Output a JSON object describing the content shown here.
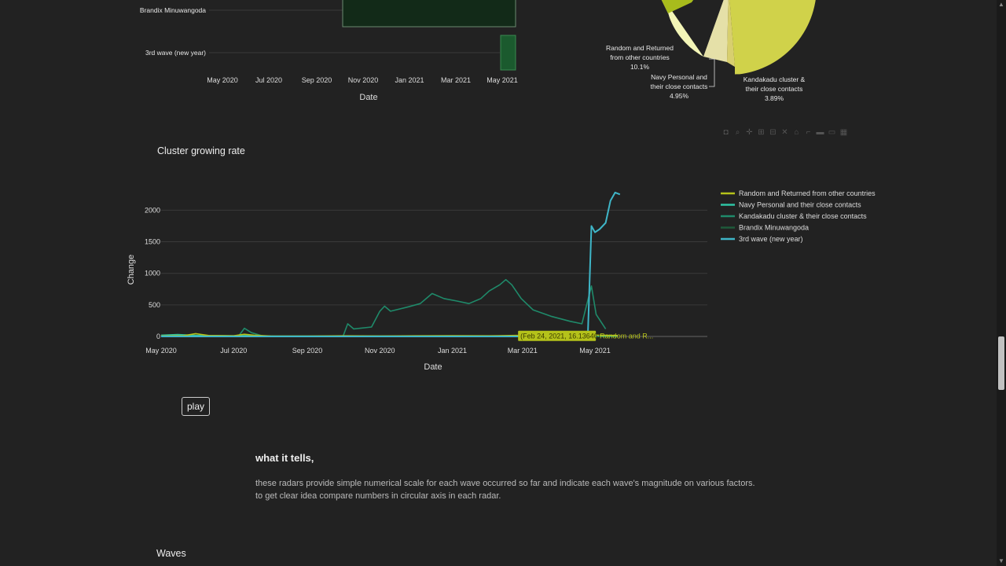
{
  "colors": {
    "background": "#222222",
    "random": "#b5c21a",
    "navy": "#2ec4a4",
    "kandakadu": "#1f8a6a",
    "brandix": "#1e5b3b",
    "third_wave": "#3fb6c8",
    "pie_random": "#f3f5b7",
    "pie_navy": "#e5e0a8",
    "pie_kandakadu": "#d8cf6e",
    "pie_main": "#d0d24a",
    "pie_green": "#a8bc1c"
  },
  "top_chart": {
    "categories": [
      "Brandix Minuwangoda",
      "3rd wave (new year)"
    ],
    "x_ticks": [
      "May 2020",
      "Jul 2020",
      "Sep 2020",
      "Nov 2020",
      "Jan 2021",
      "Mar 2021",
      "May 2021"
    ],
    "x_title": "Date"
  },
  "pie": {
    "labels": [
      {
        "lines": [
          "Random and Returned",
          "from other countries"
        ],
        "pct": "10.1%"
      },
      {
        "lines": [
          "Navy Personal and",
          "their close contacts"
        ],
        "pct": "4.95%"
      },
      {
        "lines": [
          "Kandakadu cluster &",
          "their close contacts"
        ],
        "pct": "3.89%"
      }
    ]
  },
  "modebar": {
    "icons": [
      "camera-icon",
      "zoom-icon",
      "pan-icon",
      "zoom-in-icon",
      "zoom-out-icon",
      "autoscale-icon",
      "reset-icon",
      "spike-icon",
      "compare-icon",
      "plotly-logo-icon"
    ]
  },
  "chart_title": "Cluster growing rate",
  "chart_data": {
    "type": "line",
    "title": "Cluster growing rate",
    "xlabel": "Date",
    "ylabel": "Change",
    "x_ticks": [
      "May 2020",
      "Jul 2020",
      "Sep 2020",
      "Nov 2020",
      "Jan 2021",
      "Mar 2021",
      "May 2021"
    ],
    "x_range": [
      "2020-05-01",
      "2021-05-31"
    ],
    "y_ticks": [
      0,
      500,
      1000,
      1500,
      2000
    ],
    "ylim": [
      -20,
      2300
    ],
    "legend_position": "top-right",
    "series": [
      {
        "name": "Random and Returned from other countries",
        "points": [
          [
            "2020-05-01",
            8
          ],
          [
            "2020-05-20",
            12
          ],
          [
            "2020-05-30",
            45
          ],
          [
            "2020-06-10",
            15
          ],
          [
            "2020-07-01",
            10
          ],
          [
            "2020-07-10",
            35
          ],
          [
            "2020-07-18",
            20
          ],
          [
            "2020-08-01",
            8
          ],
          [
            "2020-09-01",
            5
          ],
          [
            "2020-10-01",
            10
          ],
          [
            "2020-11-01",
            8
          ],
          [
            "2020-12-01",
            10
          ],
          [
            "2021-01-01",
            12
          ],
          [
            "2021-02-01",
            10
          ],
          [
            "2021-02-24",
            16
          ],
          [
            "2021-03-10",
            10
          ],
          [
            "2021-04-01",
            12
          ],
          [
            "2021-05-01",
            20
          ],
          [
            "2021-05-20",
            15
          ]
        ]
      },
      {
        "name": "Navy Personal and their close contacts",
        "points": [
          [
            "2020-05-01",
            20
          ],
          [
            "2020-05-15",
            30
          ],
          [
            "2020-06-01",
            15
          ],
          [
            "2020-07-01",
            10
          ],
          [
            "2020-07-12",
            15
          ],
          [
            "2020-08-01",
            5
          ],
          [
            "2021-05-20",
            5
          ]
        ]
      },
      {
        "name": "Kandakadu cluster & their close contacts",
        "points": [
          [
            "2020-05-01",
            0
          ],
          [
            "2020-07-05",
            0
          ],
          [
            "2020-07-10",
            130
          ],
          [
            "2020-07-16",
            60
          ],
          [
            "2020-07-25",
            10
          ],
          [
            "2020-08-10",
            0
          ],
          [
            "2020-10-01",
            0
          ],
          [
            "2020-10-05",
            200
          ],
          [
            "2020-10-10",
            120
          ],
          [
            "2020-10-25",
            150
          ],
          [
            "2020-11-01",
            400
          ],
          [
            "2020-11-05",
            480
          ],
          [
            "2020-11-10",
            400
          ],
          [
            "2020-11-25",
            470
          ],
          [
            "2020-12-05",
            520
          ],
          [
            "2020-12-15",
            680
          ],
          [
            "2020-12-25",
            600
          ],
          [
            "2021-01-05",
            560
          ],
          [
            "2021-01-15",
            520
          ],
          [
            "2021-01-25",
            600
          ],
          [
            "2021-02-01",
            720
          ],
          [
            "2021-02-10",
            820
          ],
          [
            "2021-02-15",
            900
          ],
          [
            "2021-02-20",
            820
          ],
          [
            "2021-02-28",
            600
          ],
          [
            "2021-03-10",
            420
          ],
          [
            "2021-03-25",
            320
          ],
          [
            "2021-04-10",
            240
          ],
          [
            "2021-04-20",
            200
          ],
          [
            "2021-04-28",
            800
          ],
          [
            "2021-05-02",
            350
          ],
          [
            "2021-05-10",
            120
          ]
        ]
      },
      {
        "name": "Brandix Minuwangoda",
        "points": [
          [
            "2020-05-01",
            0
          ],
          [
            "2021-05-20",
            0
          ]
        ]
      },
      {
        "name": "3rd wave (new year)",
        "points": [
          [
            "2020-05-01",
            0
          ],
          [
            "2021-04-25",
            0
          ],
          [
            "2021-04-28",
            1750
          ],
          [
            "2021-05-01",
            1650
          ],
          [
            "2021-05-05",
            1700
          ],
          [
            "2021-05-10",
            1800
          ],
          [
            "2021-05-14",
            2150
          ],
          [
            "2021-05-18",
            2280
          ],
          [
            "2021-05-22",
            2250
          ]
        ]
      }
    ],
    "hover_label": {
      "date": "2021-02-24",
      "value": 16.13646,
      "text": "(Feb 24, 2021, 16.13646)",
      "series_text": "Random and R..."
    }
  },
  "play_label": "play",
  "section": {
    "title": "what it tells,",
    "body": "these radars provide simple numerical scale for each wave occurred so far and indicate each wave's magnitude on various factors. to get clear idea compare numbers in circular axis in each radar."
  },
  "waves_title": "Waves"
}
